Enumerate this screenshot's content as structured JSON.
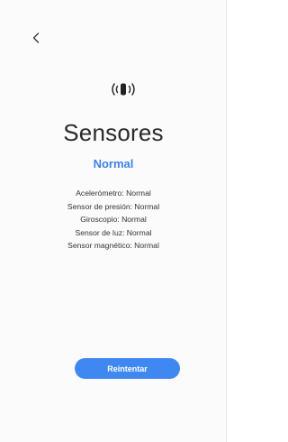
{
  "header": {
    "back_icon": "chevron-left-icon"
  },
  "main": {
    "icon": "sensor-vibration-icon",
    "title": "Sensores",
    "status": "Normal",
    "status_color": "#3e82ea",
    "results": [
      "Acelerómetro: Normal",
      "Sensor de presión: Normal",
      "Giroscopio: Normal",
      "Sensor de luz: Normal",
      "Sensor magnético: Normal"
    ]
  },
  "footer": {
    "retry_label": "Reintentar",
    "retry_color": "#3f88f2"
  }
}
